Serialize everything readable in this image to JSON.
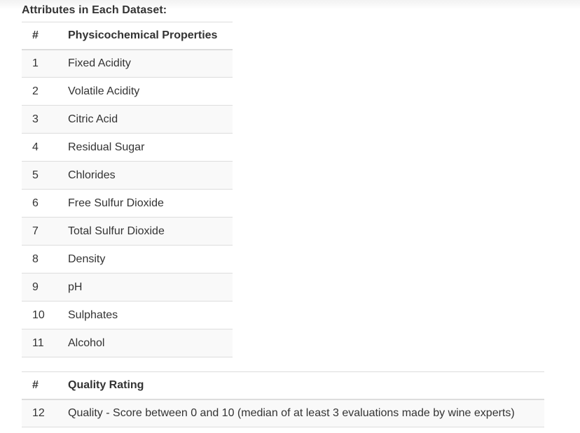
{
  "heading": "Attributes in Each Dataset:",
  "attributes_table": {
    "headers": [
      "#",
      "Physicochemical Properties"
    ],
    "rows": [
      {
        "num": "1",
        "name": "Fixed Acidity"
      },
      {
        "num": "2",
        "name": "Volatile Acidity"
      },
      {
        "num": "3",
        "name": "Citric Acid"
      },
      {
        "num": "4",
        "name": "Residual Sugar"
      },
      {
        "num": "5",
        "name": "Chlorides"
      },
      {
        "num": "6",
        "name": "Free Sulfur Dioxide"
      },
      {
        "num": "7",
        "name": "Total Sulfur Dioxide"
      },
      {
        "num": "8",
        "name": "Density"
      },
      {
        "num": "9",
        "name": "pH"
      },
      {
        "num": "10",
        "name": "Sulphates"
      },
      {
        "num": "11",
        "name": "Alcohol"
      }
    ]
  },
  "quality_table": {
    "headers": [
      "#",
      "Quality Rating"
    ],
    "rows": [
      {
        "num": "12",
        "name": "Quality - Score between 0 and 10 (median of at least 3 evaluations made by wine experts)"
      }
    ]
  },
  "colors": {
    "text": "#333333",
    "border": "#dddddd",
    "stripe": "#f9f9f9"
  }
}
